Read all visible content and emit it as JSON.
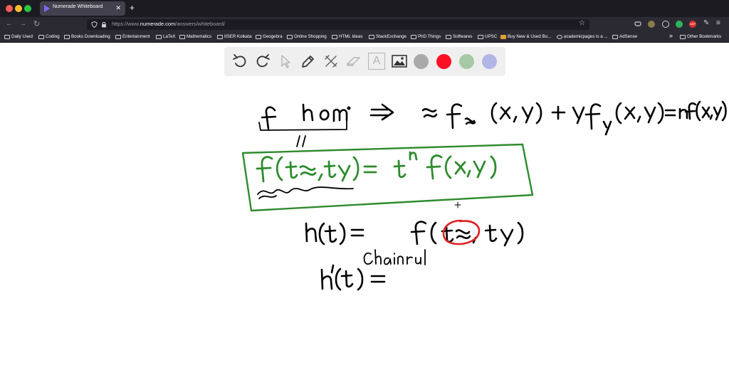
{
  "browser": {
    "tab_title": "Numerade Whiteboard",
    "tab_close": "✕",
    "new_tab": "+",
    "url_prefix": "https://www.",
    "url_domain": "numerade.com",
    "url_path": "/answers/whiteboard/",
    "extension_labels": [
      "ABP"
    ]
  },
  "bookmarks": [
    "Daily Used",
    "Coding",
    "Books Downloading",
    "Entertainment",
    "LaTeX",
    "Mathematics",
    "IISER Kolkata",
    "Geogebra",
    "Online Shopping",
    "HTML Ideas",
    "StackExchange",
    "PhD Things",
    "Softwares",
    "UPSC",
    "Buy New & Used Bo...",
    "academicpages is a ...",
    "AdSense"
  ],
  "bookmarks_overflow": "»",
  "other_bookmarks": "Other Bookmarks",
  "toolbar": {
    "tools": [
      "undo-icon",
      "redo-icon",
      "pointer-icon",
      "pencil-icon",
      "tools-icon",
      "eraser-icon",
      "text-icon",
      "image-icon"
    ],
    "text_tool_label": "A",
    "colors": [
      {
        "name": "gray",
        "hex": "#a9a9a9"
      },
      {
        "name": "red",
        "hex": "#ff0f24"
      },
      {
        "name": "light-green",
        "hex": "#a6c9a6"
      },
      {
        "name": "lavender",
        "hex": "#b3b5e6"
      }
    ]
  },
  "whiteboard": {
    "handwriting": {
      "line1_left": "f hom.",
      "implies": "⇒",
      "line1_right": "x f_x (x, y) + y f_y (x, y) = n f(x, y)",
      "equality_mark": "//",
      "boxed": "f(tx, ty) = t^n f(x, y)",
      "line3": "h(t) = f(tx, ty)",
      "line4": "h'(t) =",
      "annotation": "Chainrul"
    },
    "colors": {
      "ink": "#000000",
      "green": "#2e8b2e",
      "red": "#e02020"
    }
  }
}
